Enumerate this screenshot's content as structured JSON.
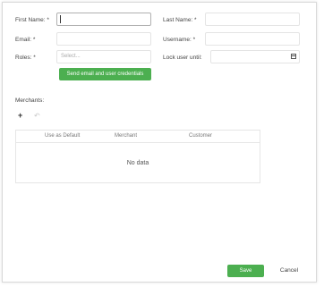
{
  "form": {
    "first_name_label": "First Name: *",
    "last_name_label": "Last Name: *",
    "email_label": "Email: *",
    "username_label": "Username: *",
    "roles_label": "Roles: *",
    "roles_placeholder": "Select...",
    "lock_user_until_label": "Lock user until:",
    "send_email_button": "Send email and user credentials"
  },
  "merchants": {
    "label": "Merchants:",
    "add_icon": "plus-icon",
    "undo_icon": "undo-icon",
    "columns": [
      "Use as Default",
      "Merchant",
      "Customer"
    ],
    "empty_text": "No data"
  },
  "footer": {
    "save_label": "Save",
    "cancel_label": "Cancel"
  },
  "colors": {
    "accent_green": "#4caf50"
  }
}
